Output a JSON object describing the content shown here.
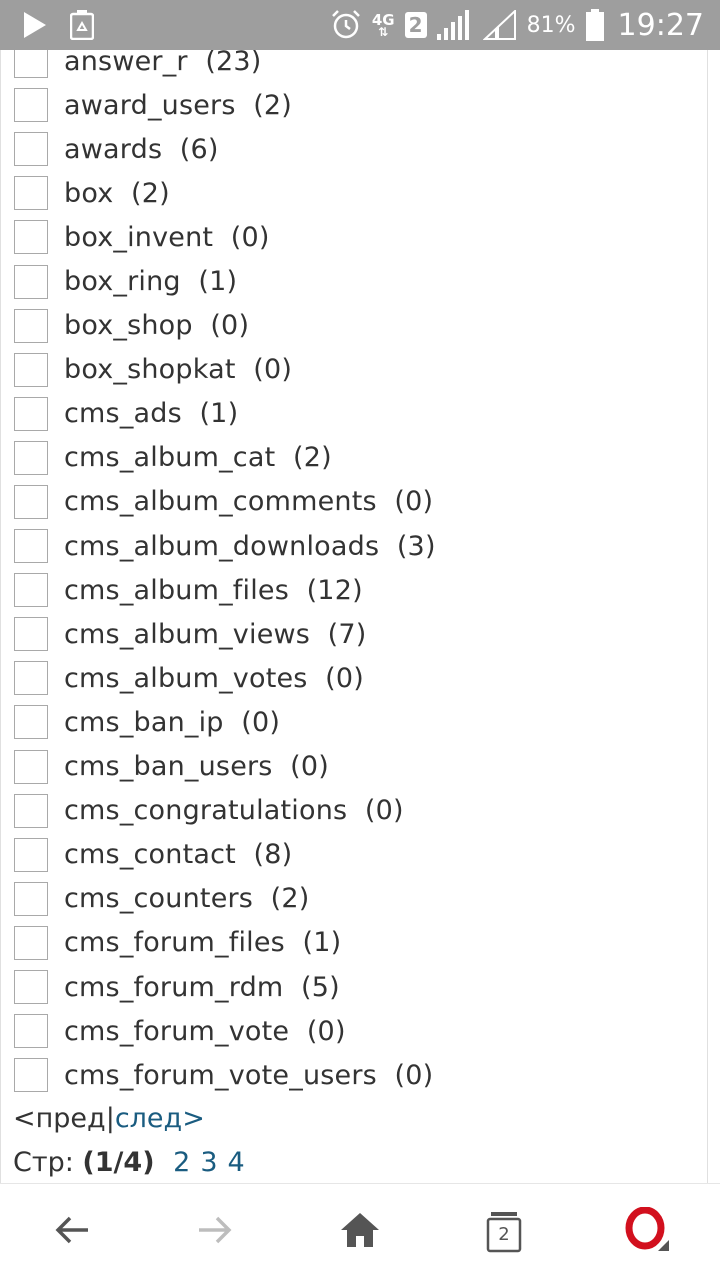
{
  "status_bar": {
    "network": "4G",
    "sim_slot": "2",
    "battery": "81%",
    "time": "19:27",
    "icons": [
      "play-icon",
      "recycle-icon",
      "alarm-icon",
      "signal-icon",
      "signal-icon",
      "battery-icon"
    ]
  },
  "tables": [
    {
      "name": "answer_r",
      "count": "(23)"
    },
    {
      "name": "award_users",
      "count": "(2)"
    },
    {
      "name": "awards",
      "count": "(6)"
    },
    {
      "name": "box",
      "count": "(2)"
    },
    {
      "name": "box_invent",
      "count": "(0)"
    },
    {
      "name": "box_ring",
      "count": "(1)"
    },
    {
      "name": "box_shop",
      "count": "(0)"
    },
    {
      "name": "box_shopkat",
      "count": "(0)"
    },
    {
      "name": "cms_ads",
      "count": "(1)"
    },
    {
      "name": "cms_album_cat",
      "count": "(2)"
    },
    {
      "name": "cms_album_comments",
      "count": "(0)"
    },
    {
      "name": "cms_album_downloads",
      "count": "(3)"
    },
    {
      "name": "cms_album_files",
      "count": "(12)"
    },
    {
      "name": "cms_album_views",
      "count": "(7)"
    },
    {
      "name": "cms_album_votes",
      "count": "(0)"
    },
    {
      "name": "cms_ban_ip",
      "count": "(0)"
    },
    {
      "name": "cms_ban_users",
      "count": "(0)"
    },
    {
      "name": "cms_congratulations",
      "count": "(0)"
    },
    {
      "name": "cms_contact",
      "count": "(8)"
    },
    {
      "name": "cms_counters",
      "count": "(2)"
    },
    {
      "name": "cms_forum_files",
      "count": "(1)"
    },
    {
      "name": "cms_forum_rdm",
      "count": "(5)"
    },
    {
      "name": "cms_forum_vote",
      "count": "(0)"
    },
    {
      "name": "cms_forum_vote_users",
      "count": "(0)"
    }
  ],
  "pager": {
    "prev": "<пред",
    "separator": "|",
    "next": "след>"
  },
  "pages": {
    "label": "Стр:",
    "current": "(1/4)",
    "links": [
      "2",
      "3",
      "4"
    ]
  },
  "nav": {
    "tab_count": "2",
    "icons": [
      "back-arrow-icon",
      "forward-arrow-icon",
      "home-icon",
      "tabs-icon",
      "opera-menu-icon"
    ]
  },
  "colors": {
    "status_bar": "#9e9e9e",
    "link": "#1a5c80",
    "text": "#333333",
    "opera_red": "#d2101e"
  }
}
